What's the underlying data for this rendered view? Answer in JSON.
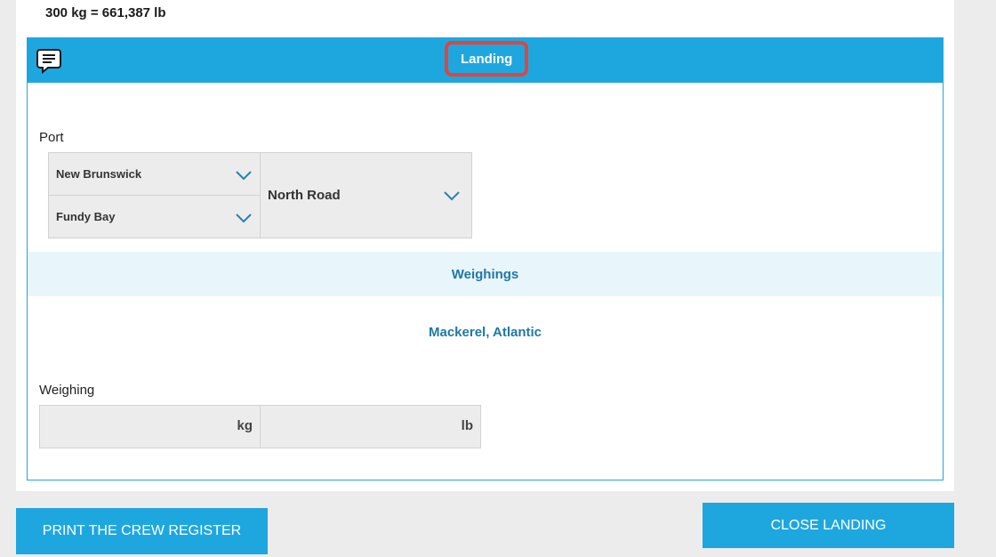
{
  "conversion_text": "300 kg = 661,387 lb",
  "panel": {
    "title": "Landing",
    "comment_icon": "comment-icon"
  },
  "port": {
    "label": "Port",
    "province": "New Brunswick",
    "area": "Fundy Bay",
    "port_name": "North Road",
    "chevron_icon": "chevron-down-icon"
  },
  "weighings": {
    "header": "Weighings",
    "species": "Mackerel, Atlantic",
    "label": "Weighing",
    "unit_kg": "kg",
    "unit_lb": "lb"
  },
  "buttons": {
    "print_crew": "PRINT THE CREW REGISTER",
    "close_landing": "CLOSE LANDING"
  },
  "colors": {
    "accent": "#1ea7df",
    "highlight": "#e0453f",
    "link_text": "#1f78a5",
    "band": "#e8f6fc"
  }
}
